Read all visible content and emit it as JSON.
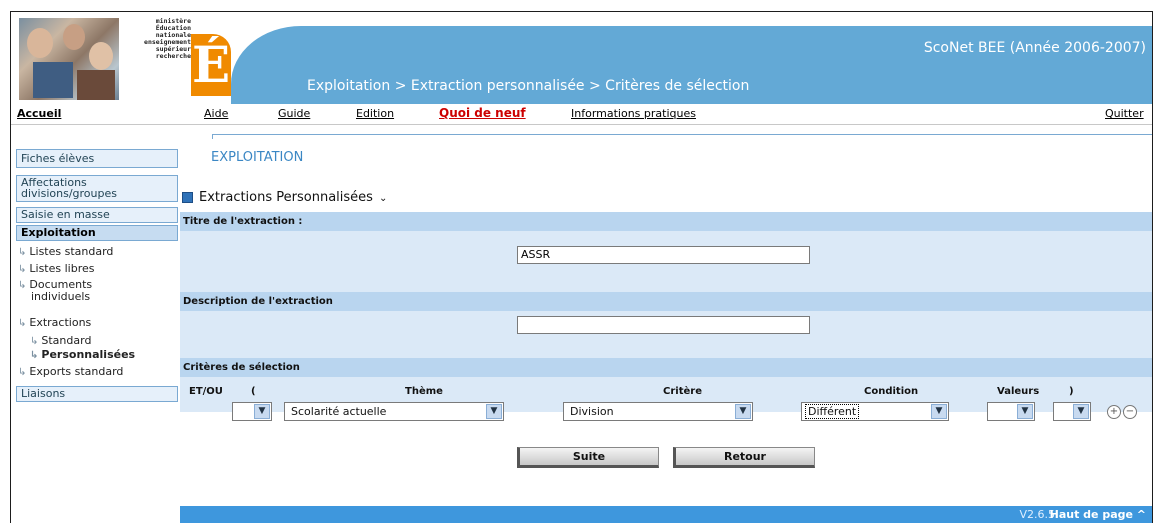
{
  "header": {
    "ministry_lines": [
      "ministère",
      "Éducation",
      "nationale",
      "enseignement",
      "supérieur",
      "recherche"
    ],
    "logo_letter": "É",
    "app_title": "ScoNet BEE (Année 2006-2007)",
    "breadcrumb": "Exploitation > Extraction personnalisée > Critères de sélection"
  },
  "topnav": {
    "home": "Accueil",
    "aide": "Aide",
    "guide": "Guide",
    "edition": "Edition",
    "quoi_de_neuf": "Quoi de neuf",
    "infos": "Informations pratiques",
    "quitter": "Quitter"
  },
  "sidebar": {
    "fiches": "Fiches élèves",
    "affect_1": "Affectations",
    "affect_2": "divisions/groupes",
    "saisie": "Saisie en masse",
    "exploitation": "Exploitation",
    "listes_standard": "Listes standard",
    "listes_libres": "Listes libres",
    "docs_1": "Documents",
    "docs_2": "individuels",
    "extractions": "Extractions",
    "standard": "Standard",
    "personnalisees": "Personnalisées",
    "exports": "Exports standard",
    "liaisons": "Liaisons"
  },
  "main": {
    "section_title": "EXPLOITATION",
    "heading": "Extractions Personnalisées",
    "titre_label": "Titre de l'extraction :",
    "titre_value": "ASSR",
    "desc_label": "Description de l'extraction",
    "desc_value": "",
    "criteres_label": "Critères de sélection",
    "columns": {
      "etou": "ET/OU",
      "open_paren": "(",
      "theme": "Thème",
      "critere": "Critère",
      "condition": "Condition",
      "valeurs": "Valeurs",
      "close_paren": ")"
    },
    "row": {
      "theme": "Scolarité actuelle",
      "critere": "Division",
      "condition": "Différent"
    },
    "suite": "Suite",
    "retour": "Retour"
  },
  "footer": {
    "version": "V2.6.5",
    "haut": "Haut de page ^"
  },
  "colors": {
    "banner": "#63a9d6",
    "footer": "#3e97dd",
    "form_bg": "#dbe9f7",
    "bar_bg": "#b9d5ef",
    "logo": "#f08a00"
  }
}
